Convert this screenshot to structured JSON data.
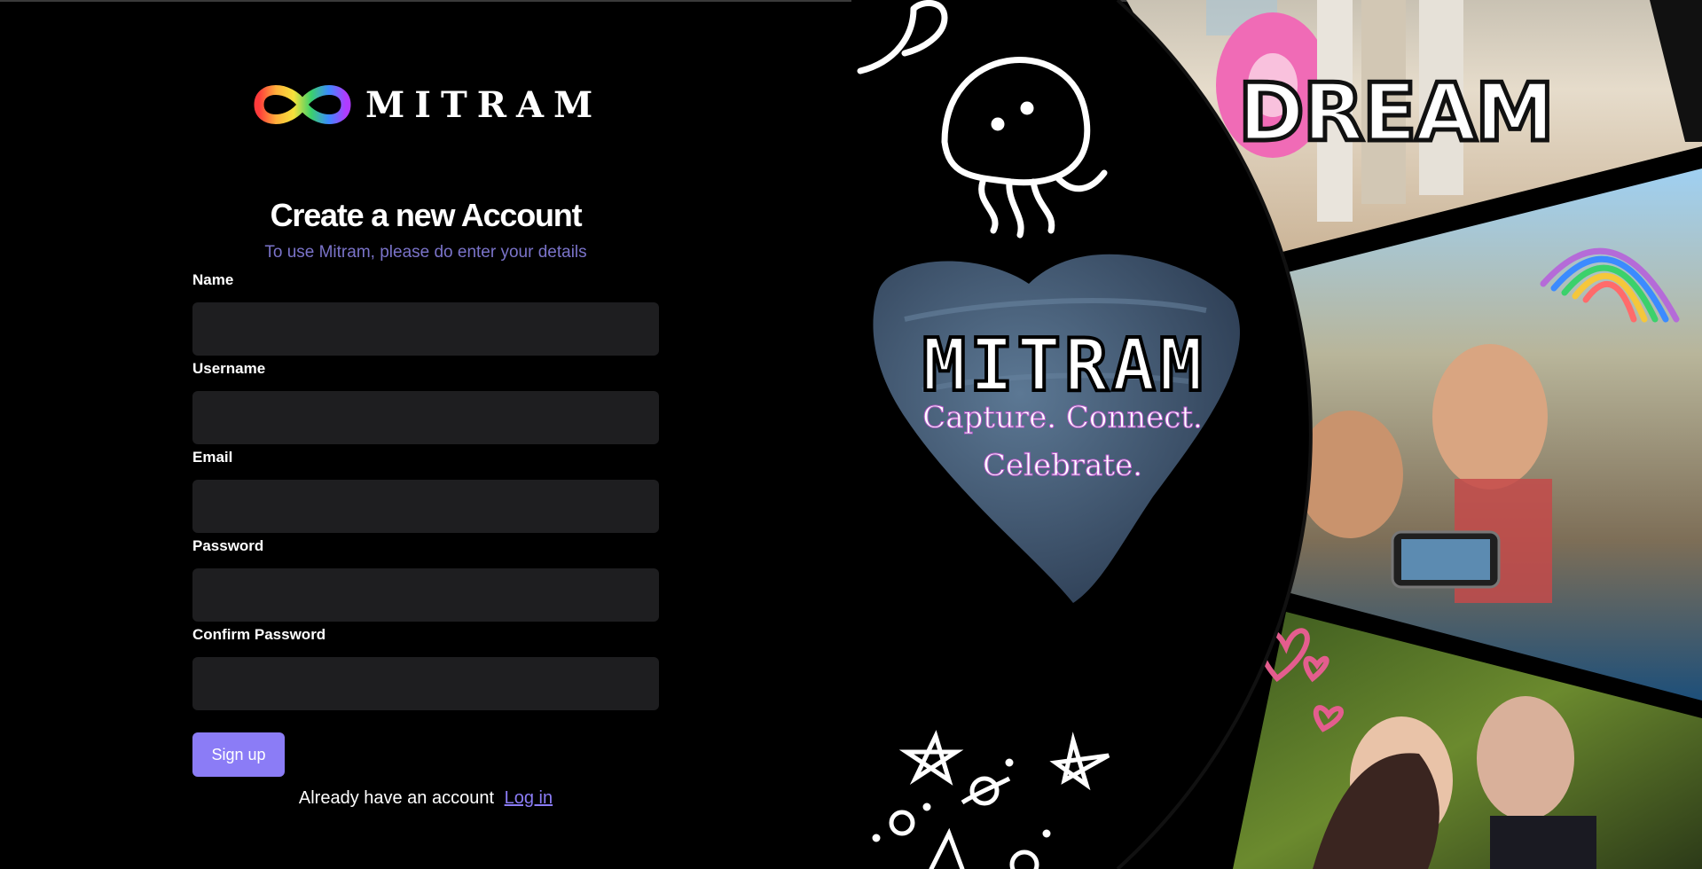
{
  "brand": {
    "name": "MITRAM"
  },
  "form": {
    "title": "Create a new Account",
    "subtitle": "To use Mitram, please do enter your details",
    "fields": [
      {
        "label": "Name",
        "value": "",
        "placeholder": ""
      },
      {
        "label": "Username",
        "value": "",
        "placeholder": ""
      },
      {
        "label": "Email",
        "value": "",
        "placeholder": ""
      },
      {
        "label": "Password",
        "value": "",
        "placeholder": ""
      },
      {
        "label": "Confirm Password",
        "value": "",
        "placeholder": ""
      }
    ],
    "submit_label": "Sign up",
    "login_prompt": "Already have an account",
    "login_link": "Log in"
  },
  "hero": {
    "brand": "MITRAM",
    "tagline_line1": "Capture. Connect.",
    "tagline_line2": "Celebrate.",
    "photo1_word": "DREAM",
    "icons": [
      "jellyfish-doodle-icon",
      "heart-brush-icon",
      "rainbow-doodle-icon",
      "hearts-doodle-icon",
      "stars-doodle-icon",
      "planet-doodle-icon"
    ]
  },
  "colors": {
    "accent": "#8b7cf6",
    "input_bg": "#1e1e20",
    "subtitle": "#7a73c9",
    "background": "#000000"
  }
}
